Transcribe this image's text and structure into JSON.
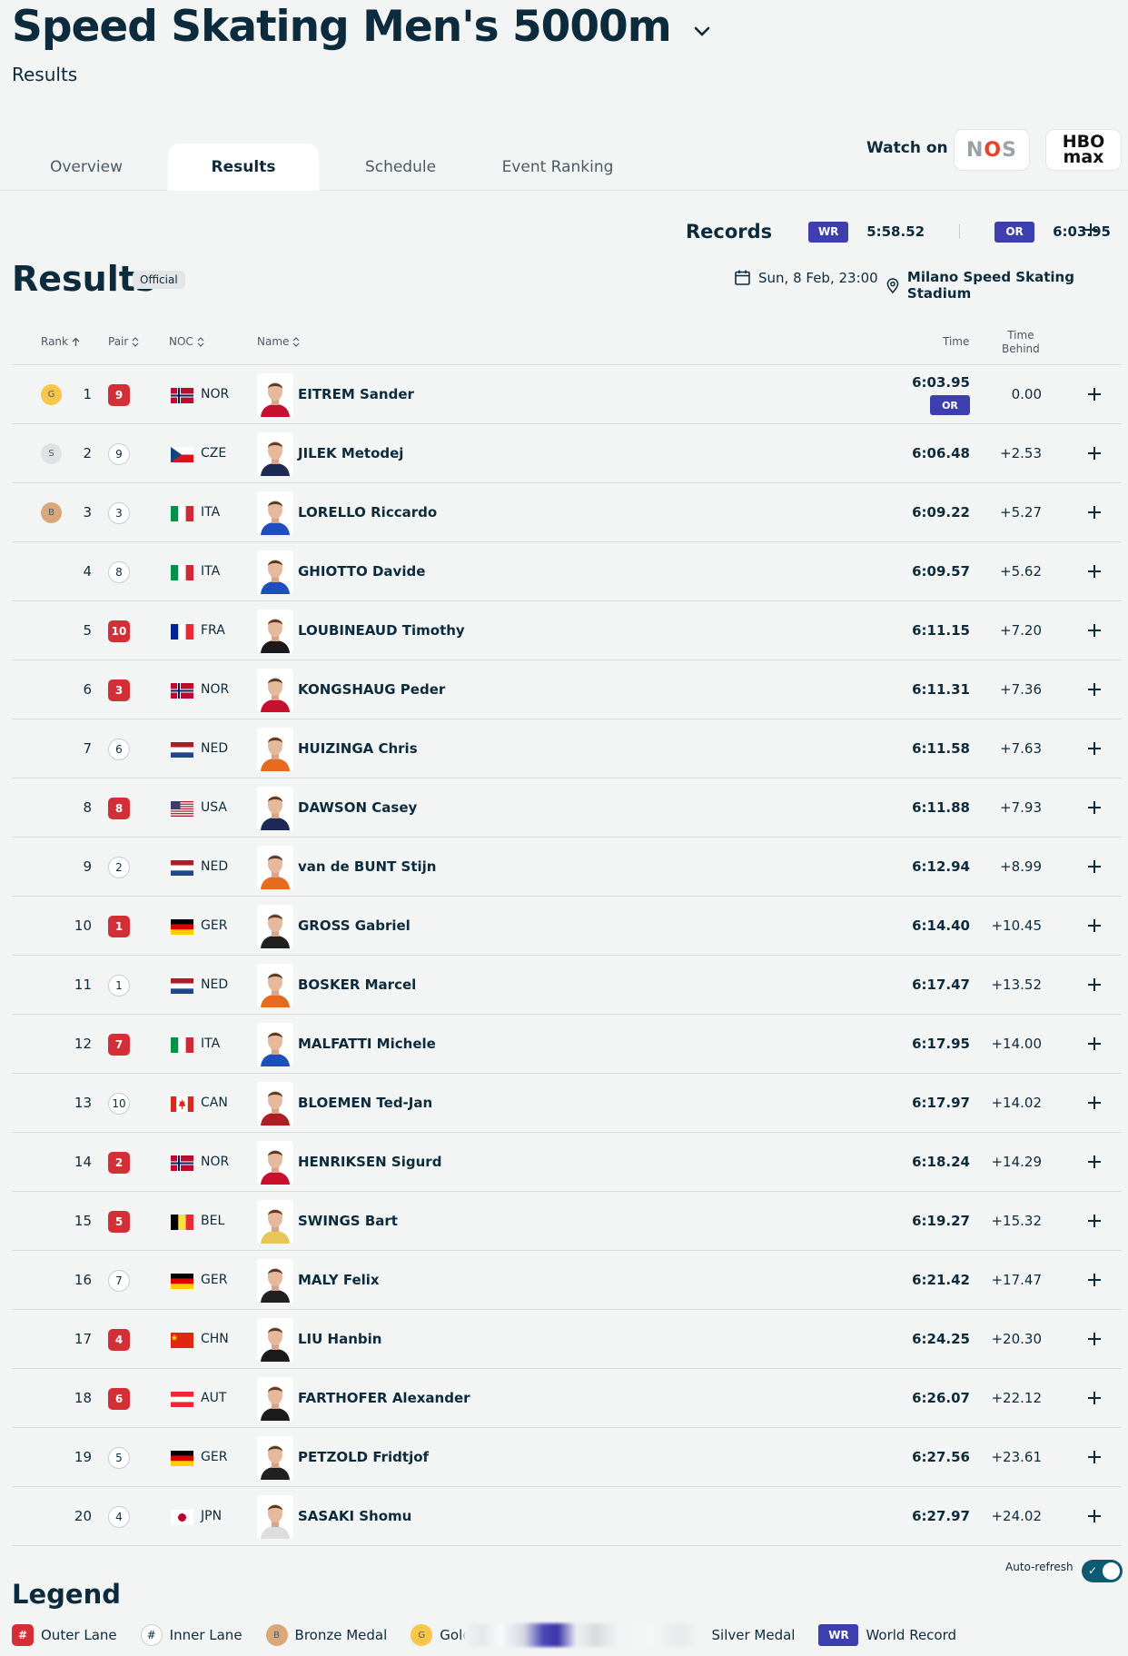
{
  "header": {
    "title": "Speed Skating Men's 5000m",
    "subtitle": "Results"
  },
  "tabs": [
    {
      "label": "Overview",
      "active": false
    },
    {
      "label": "Results",
      "active": true
    },
    {
      "label": "Schedule",
      "active": false
    },
    {
      "label": "Event Ranking",
      "active": false
    }
  ],
  "watch": {
    "label": "Watch on",
    "broadcasters": [
      "NOS",
      "HBO max"
    ]
  },
  "records": {
    "label": "Records",
    "wr_badge": "WR",
    "wr_value": "5:58.52",
    "or_badge": "OR",
    "or_value": "6:03.95"
  },
  "results": {
    "title": "Results",
    "status": "Official",
    "date": "Sun, 8 Feb, 23:00",
    "venue": "Milano Speed Skating Stadium"
  },
  "table": {
    "headers": {
      "rank": "Rank",
      "pair": "Pair",
      "noc": "NOC",
      "name": "Name",
      "time": "Time",
      "time_behind_1": "Time",
      "time_behind_2": "Behind"
    },
    "rows": [
      {
        "rank": "1",
        "medal": "G",
        "pair": "9",
        "lane": "outer",
        "noc": "NOR",
        "name": "EITREM Sander",
        "time": "6:03.95",
        "badge": "OR",
        "behind": "0.00"
      },
      {
        "rank": "2",
        "medal": "S",
        "pair": "9",
        "lane": "inner",
        "noc": "CZE",
        "name": "JILEK Metodej",
        "time": "6:06.48",
        "behind": "+2.53"
      },
      {
        "rank": "3",
        "medal": "B",
        "pair": "3",
        "lane": "inner",
        "noc": "ITA",
        "name": "LORELLO Riccardo",
        "time": "6:09.22",
        "behind": "+5.27"
      },
      {
        "rank": "4",
        "pair": "8",
        "lane": "inner",
        "noc": "ITA",
        "name": "GHIOTTO Davide",
        "time": "6:09.57",
        "behind": "+5.62"
      },
      {
        "rank": "5",
        "pair": "10",
        "lane": "outer",
        "noc": "FRA",
        "name": "LOUBINEAUD Timothy",
        "time": "6:11.15",
        "behind": "+7.20"
      },
      {
        "rank": "6",
        "pair": "3",
        "lane": "outer",
        "noc": "NOR",
        "name": "KONGSHAUG Peder",
        "time": "6:11.31",
        "behind": "+7.36"
      },
      {
        "rank": "7",
        "pair": "6",
        "lane": "inner",
        "noc": "NED",
        "name": "HUIZINGA Chris",
        "time": "6:11.58",
        "behind": "+7.63"
      },
      {
        "rank": "8",
        "pair": "8",
        "lane": "outer",
        "noc": "USA",
        "name": "DAWSON Casey",
        "time": "6:11.88",
        "behind": "+7.93"
      },
      {
        "rank": "9",
        "pair": "2",
        "lane": "inner",
        "noc": "NED",
        "name": "van de BUNT Stijn",
        "time": "6:12.94",
        "behind": "+8.99"
      },
      {
        "rank": "10",
        "pair": "1",
        "lane": "outer",
        "noc": "GER",
        "name": "GROSS Gabriel",
        "time": "6:14.40",
        "behind": "+10.45"
      },
      {
        "rank": "11",
        "pair": "1",
        "lane": "inner",
        "noc": "NED",
        "name": "BOSKER Marcel",
        "time": "6:17.47",
        "behind": "+13.52"
      },
      {
        "rank": "12",
        "pair": "7",
        "lane": "outer",
        "noc": "ITA",
        "name": "MALFATTI Michele",
        "time": "6:17.95",
        "behind": "+14.00"
      },
      {
        "rank": "13",
        "pair": "10",
        "lane": "inner",
        "noc": "CAN",
        "name": "BLOEMEN Ted-Jan",
        "time": "6:17.97",
        "behind": "+14.02"
      },
      {
        "rank": "14",
        "pair": "2",
        "lane": "outer",
        "noc": "NOR",
        "name": "HENRIKSEN Sigurd",
        "time": "6:18.24",
        "behind": "+14.29"
      },
      {
        "rank": "15",
        "pair": "5",
        "lane": "outer",
        "noc": "BEL",
        "name": "SWINGS Bart",
        "time": "6:19.27",
        "behind": "+15.32"
      },
      {
        "rank": "16",
        "pair": "7",
        "lane": "inner",
        "noc": "GER",
        "name": "MALY Felix",
        "time": "6:21.42",
        "behind": "+17.47"
      },
      {
        "rank": "17",
        "pair": "4",
        "lane": "outer",
        "noc": "CHN",
        "name": "LIU Hanbin",
        "time": "6:24.25",
        "behind": "+20.30"
      },
      {
        "rank": "18",
        "pair": "6",
        "lane": "outer",
        "noc": "AUT",
        "name": "FARTHOFER Alexander",
        "time": "6:26.07",
        "behind": "+22.12"
      },
      {
        "rank": "19",
        "pair": "5",
        "lane": "inner",
        "noc": "GER",
        "name": "PETZOLD Fridtjof",
        "time": "6:27.56",
        "behind": "+23.61"
      },
      {
        "rank": "20",
        "pair": "4",
        "lane": "inner",
        "noc": "JPN",
        "name": "SASAKI Shomu",
        "time": "6:27.97",
        "behind": "+24.02"
      }
    ]
  },
  "auto_refresh": {
    "label": "Auto-refresh",
    "on": true
  },
  "legend": {
    "title": "Legend",
    "items": [
      {
        "symbol": "#",
        "kind": "outer",
        "label": "Outer Lane"
      },
      {
        "symbol": "#",
        "kind": "inner",
        "label": "Inner Lane"
      },
      {
        "symbol": "B",
        "kind": "bronze",
        "label": "Bronze Medal"
      },
      {
        "symbol": "G",
        "kind": "gold",
        "label": "Golc"
      },
      {
        "symbol": "",
        "kind": "silver",
        "label": "Silver Medal"
      },
      {
        "symbol": "WR",
        "kind": "wr",
        "label": "World Record"
      }
    ]
  },
  "colors": {
    "accent_navy": "#0c2b3c",
    "record_badge": "#3c3fad",
    "outer_lane": "#d32f36",
    "gold": "#f7c64b",
    "silver": "#dfe2e4",
    "bronze": "#d9a87a"
  },
  "icons": [
    "chevron-down-icon",
    "plus-icon",
    "calendar-icon",
    "location-pin-icon",
    "sort-icon",
    "check-icon"
  ]
}
